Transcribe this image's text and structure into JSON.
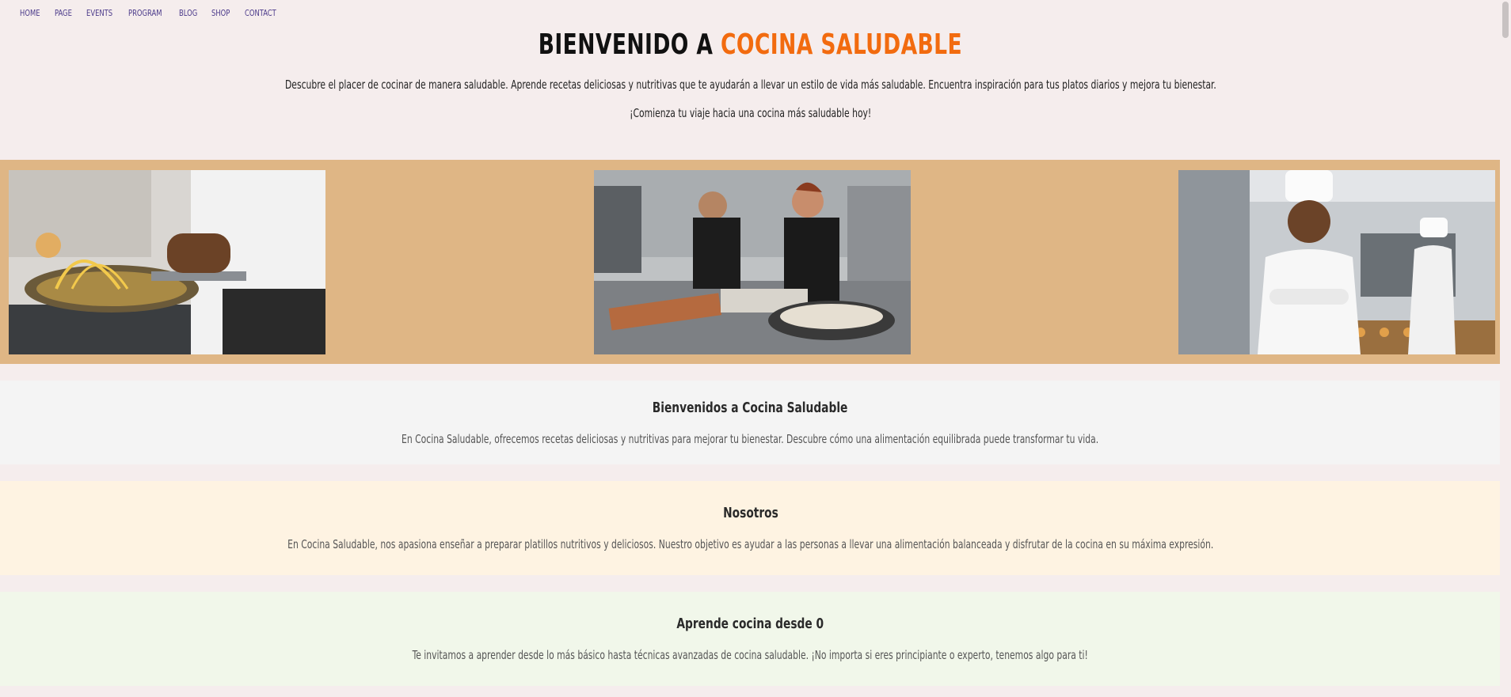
{
  "nav": {
    "items": [
      {
        "label": "HOME"
      },
      {
        "label": "PAGE"
      },
      {
        "label": "EVENTS"
      },
      {
        "label": "PROGRAM"
      },
      {
        "label": "BLOG"
      },
      {
        "label": "SHOP"
      },
      {
        "label": "CONTACT"
      }
    ]
  },
  "hero": {
    "title_prefix": "BIENVENIDO A ",
    "title_accent": "COCINA SALUDABLE",
    "paragraph1": "Descubre el placer de cocinar de manera saludable. Aprende recetas deliciosas y nutritivas que te ayudarán a llevar un estilo de vida más saludable. Encuentra inspiración para tus platos diarios y mejora tu bienestar.",
    "paragraph2": "¡Comienza tu viaje hacia una cocina más saludable hoy!"
  },
  "sections": [
    {
      "title": "Bienvenidos a Cocina Saludable",
      "text": "En Cocina Saludable, ofrecemos recetas deliciosas y nutritivas para mejorar tu bienestar. Descubre cómo una alimentación equilibrada puede transformar tu vida."
    },
    {
      "title": "Nosotros",
      "text": "En Cocina Saludable, nos apasiona enseñar a preparar platillos nutritivos y deliciosos. Nuestro objetivo es ayudar a las personas a llevar una alimentación balanceada y disfrutar de la cocina en su máxima expresión."
    },
    {
      "title": "Aprende cocina desde 0",
      "text": "Te invitamos a aprender desde lo más básico hasta técnicas avanzadas de cocina saludable. ¡No importa si eres principiante o experto, tenemos algo para ti!"
    }
  ],
  "colors": {
    "accent": "#f26b0f",
    "nav_link": "#4b3a8a",
    "gallery_bg": "#dfb685",
    "page_bg": "#f5eded"
  }
}
